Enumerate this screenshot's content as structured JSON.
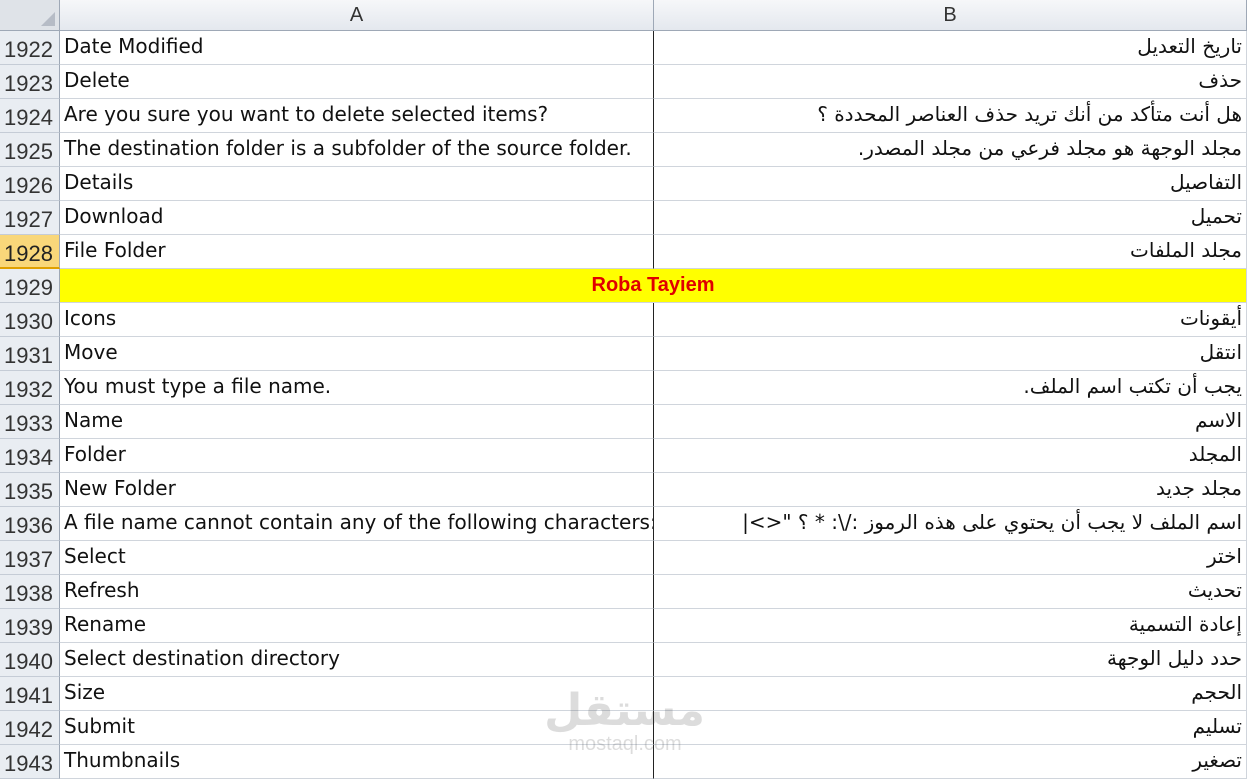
{
  "columns": {
    "a": "A",
    "b": "B"
  },
  "active_row": "1928",
  "rows": [
    {
      "num": "1922",
      "a": "Date Modified",
      "b": "تاريخ التعديل"
    },
    {
      "num": "1923",
      "a": "Delete",
      "b": "حذف"
    },
    {
      "num": "1924",
      "a": "Are you sure you want to delete selected items?",
      "b": "هل أنت متأكد من أنك تريد حذف العناصر المحددة ؟"
    },
    {
      "num": "1925",
      "a": "The destination folder is a subfolder of the source folder.",
      "b": "مجلد الوجهة هو مجلد فرعي من مجلد المصدر."
    },
    {
      "num": "1926",
      "a": "Details",
      "b": "التفاصيل"
    },
    {
      "num": "1927",
      "a": "Download",
      "b": "تحميل"
    },
    {
      "num": "1928",
      "a": "File Folder",
      "b": "مجلد الملفات"
    },
    {
      "num": "1929",
      "merged": "Roba Tayiem"
    },
    {
      "num": "1930",
      "a": "Icons",
      "b": "أيقونات"
    },
    {
      "num": "1931",
      "a": "Move",
      "b": "انتقل"
    },
    {
      "num": "1932",
      "a": "You must type a file name.",
      "b": "يجب أن تكتب اسم الملف."
    },
    {
      "num": "1933",
      "a": "Name",
      "b": "الاسم"
    },
    {
      "num": "1934",
      "a": "Folder",
      "b": "المجلد"
    },
    {
      "num": "1935",
      "a": "New Folder",
      "b": "مجلد جديد"
    },
    {
      "num": "1936",
      "a": "A file name cannot contain any of the following characters:",
      "b": "اسم الملف لا يجب أن يحتوي على هذه الرموز :/\\: * ؟ \"<>|"
    },
    {
      "num": "1937",
      "a": "Select",
      "b": "اختر"
    },
    {
      "num": "1938",
      "a": "Refresh",
      "b": "تحديث"
    },
    {
      "num": "1939",
      "a": "Rename",
      "b": "إعادة التسمية"
    },
    {
      "num": "1940",
      "a": "Select destination directory",
      "b": "حدد دليل الوجهة"
    },
    {
      "num": "1941",
      "a": "Size",
      "b": "الحجم"
    },
    {
      "num": "1942",
      "a": "Submit",
      "b": "تسليم"
    },
    {
      "num": "1943",
      "a": "Thumbnails",
      "b": "تصغير"
    }
  ],
  "watermark": {
    "arabic": "مستقل",
    "latin": "mostaql.com"
  }
}
